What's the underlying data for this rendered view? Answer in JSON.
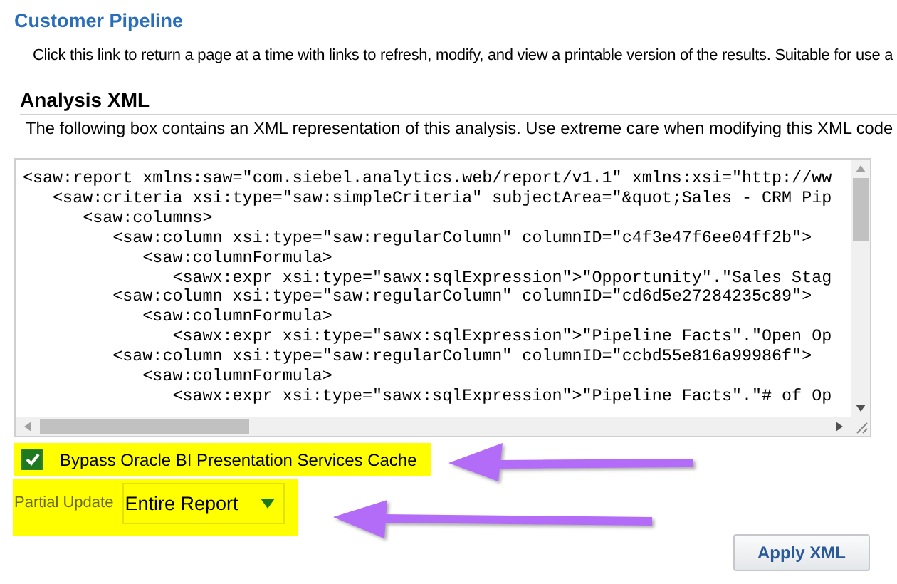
{
  "section_title": "Customer Pipeline",
  "section_description": "Click this link to return a page at a time with links to refresh, modify, and view a printable version of the results. Suitable for use a",
  "xml_panel": {
    "heading": "Analysis XML",
    "description": "The following box contains an XML representation of this analysis. Use extreme care when modifying this XML code",
    "lines": [
      "<saw:report xmlns:saw=\"com.siebel.analytics.web/report/v1.1\" xmlns:xsi=\"http://ww",
      "   <saw:criteria xsi:type=\"saw:simpleCriteria\" subjectArea=\"&quot;Sales - CRM Pip",
      "      <saw:columns>",
      "         <saw:column xsi:type=\"saw:regularColumn\" columnID=\"c4f3e47f6ee04ff2b\">",
      "            <saw:columnFormula>",
      "               <sawx:expr xsi:type=\"sawx:sqlExpression\">\"Opportunity\".\"Sales Stag",
      "         <saw:column xsi:type=\"saw:regularColumn\" columnID=\"cd6d5e27284235c89\">",
      "            <saw:columnFormula>",
      "               <sawx:expr xsi:type=\"sawx:sqlExpression\">\"Pipeline Facts\".\"Open Op",
      "         <saw:column xsi:type=\"saw:regularColumn\" columnID=\"ccbd55e816a99986f\">",
      "            <saw:columnFormula>",
      "               <sawx:expr xsi:type=\"sawx:sqlExpression\">\"Pipeline Facts\".\"# of Op"
    ]
  },
  "bypass_cache": {
    "label": "Bypass Oracle BI Presentation Services Cache",
    "checked": true
  },
  "partial_update": {
    "label": "Partial Update",
    "value": "Entire Report"
  },
  "apply_button": "Apply XML"
}
